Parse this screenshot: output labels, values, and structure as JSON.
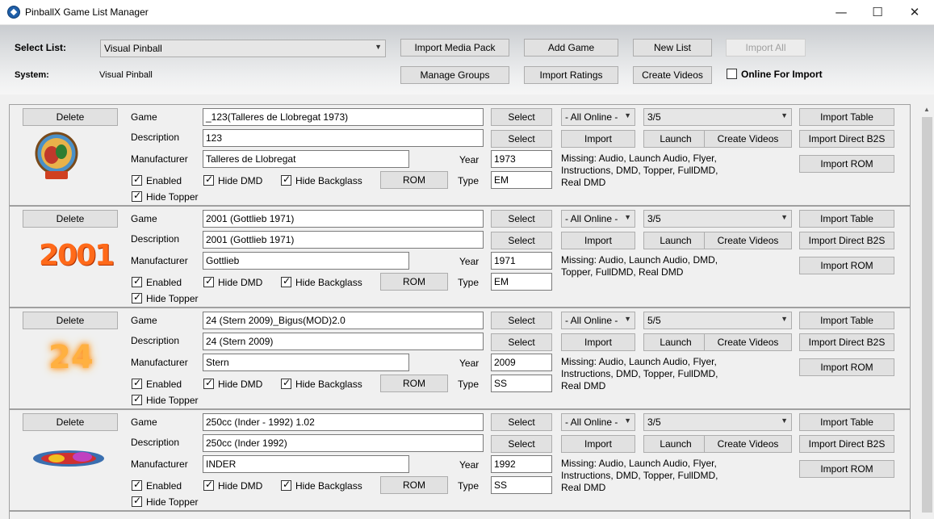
{
  "window": {
    "title": "PinballX Game List Manager",
    "minimize": "—",
    "maximize": "☐",
    "close": "✕"
  },
  "header": {
    "select_list_label": "Select List:",
    "select_list_value": "Visual Pinball",
    "system_label": "System:",
    "system_value": "Visual Pinball",
    "buttons": {
      "import_media_pack": "Import Media Pack",
      "add_game": "Add Game",
      "new_list": "New List",
      "import_all": "Import All",
      "manage_groups": "Manage Groups",
      "import_ratings": "Import Ratings",
      "create_videos": "Create Videos"
    },
    "online_for_import_label": "Online For Import",
    "online_for_import_checked": false
  },
  "labels": {
    "delete": "Delete",
    "game": "Game",
    "description": "Description",
    "manufacturer": "Manufacturer",
    "year": "Year",
    "type": "Type",
    "enabled": "Enabled",
    "hide_dmd": "Hide DMD",
    "hide_backglass": "Hide Backglass",
    "hide_topper": "Hide Topper",
    "rom": "ROM",
    "select": "Select",
    "import": "Import",
    "launch": "Launch",
    "create_videos": "Create Videos",
    "import_table": "Import Table",
    "import_direct_b2s": "Import Direct B2S",
    "import_rom": "Import ROM"
  },
  "entries": [
    {
      "game": "_123(Talleres de Llobregat 1973)",
      "description": "123",
      "manufacturer": "Talleres de Llobregat",
      "year": "1973",
      "type": "EM",
      "online": "- All Online -",
      "rating": "3/5",
      "missing": "Missing: Audio, Launch Audio, Flyer, Instructions, DMD, Topper, FullDMD, Real DMD",
      "enabled": true,
      "hide_dmd": true,
      "hide_backglass": true,
      "hide_topper": true,
      "logo_icon": "123-logo"
    },
    {
      "game": "2001 (Gottlieb 1971)",
      "description": "2001 (Gottlieb 1971)",
      "manufacturer": "Gottlieb",
      "year": "1971",
      "type": "EM",
      "online": "- All Online -",
      "rating": "3/5",
      "missing": "Missing: Audio, Launch Audio, DMD, Topper, FullDMD, Real DMD",
      "enabled": true,
      "hide_dmd": true,
      "hide_backglass": true,
      "hide_topper": true,
      "logo_icon": "2001-logo",
      "logo_text": "2001"
    },
    {
      "game": "24 (Stern 2009)_Bigus(MOD)2.0",
      "description": "24 (Stern 2009)",
      "manufacturer": "Stern",
      "year": "2009",
      "type": "SS",
      "online": "- All Online -",
      "rating": "5/5",
      "missing": "Missing: Audio, Launch Audio, Flyer, Instructions, DMD, Topper, FullDMD, Real DMD",
      "enabled": true,
      "hide_dmd": true,
      "hide_backglass": true,
      "hide_topper": true,
      "logo_icon": "24-logo",
      "logo_text": "24"
    },
    {
      "game": "250cc (Inder - 1992) 1.02",
      "description": "250cc (Inder 1992)",
      "manufacturer": "INDER",
      "year": "1992",
      "type": "SS",
      "online": "- All Online -",
      "rating": "3/5",
      "missing": "Missing: Audio, Launch Audio, Flyer, Instructions, DMD, Topper, FullDMD, Real DMD",
      "enabled": true,
      "hide_dmd": true,
      "hide_backglass": true,
      "hide_topper": true,
      "logo_icon": "250cc-logo"
    }
  ]
}
